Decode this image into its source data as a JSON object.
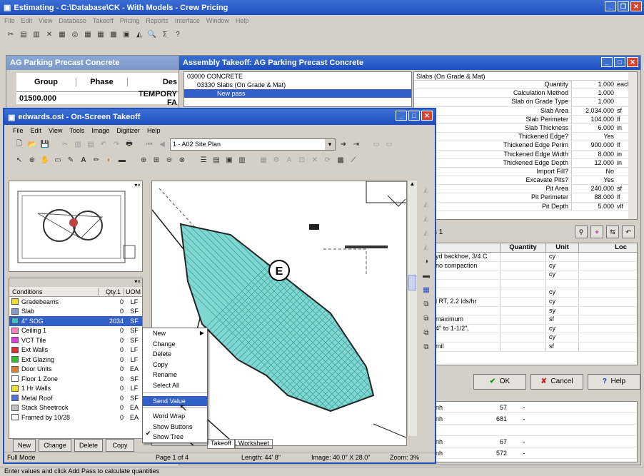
{
  "main": {
    "title": "Estimating - C:\\Database\\CK - With Models - Crew Pricing",
    "menu": [
      "File",
      "Edit",
      "View",
      "Database",
      "Takeoff",
      "Pricing",
      "Reports",
      "Interface",
      "Window",
      "Help"
    ]
  },
  "ag": {
    "title": "AG Parking Precast Concrete",
    "headers": [
      "Group",
      "Phase",
      "Des"
    ],
    "row": [
      "01500.000",
      "",
      "TEMPORY FA"
    ]
  },
  "assembly": {
    "title": "Assembly Takeoff:  AG Parking Precast Concrete",
    "tree": [
      "03000  CONCRETE",
      "03330  Slabs (On Grade & Mat)",
      "New pass"
    ],
    "props_title": "Slabs (On Grade & Mat)",
    "props": [
      {
        "label": "Quantity",
        "value": "1.000",
        "unit": "each"
      },
      {
        "label": "Calculation Method",
        "value": "1.000",
        "unit": ""
      },
      {
        "label": "Slab on Grade Type",
        "value": "1.000",
        "unit": ""
      },
      {
        "label": "Slab Area",
        "value": "2,034.000",
        "unit": "sf"
      },
      {
        "label": "Slab Perimeter",
        "value": "104.000",
        "unit": "lf"
      },
      {
        "label": "Slab Thickness",
        "value": "6.000",
        "unit": "in"
      },
      {
        "label": "Thickened Edge?",
        "value": "Yes",
        "unit": ""
      },
      {
        "label": "Thickened Edge Perim",
        "value": "900.000",
        "unit": "lf"
      },
      {
        "label": "Thickened Edge Width",
        "value": "8.000",
        "unit": "in"
      },
      {
        "label": "Thickened Edge Depth",
        "value": "12.000",
        "unit": "in"
      },
      {
        "label": "Import Fill?",
        "value": "No",
        "unit": ""
      },
      {
        "label": "Excavate Pits?",
        "value": "Yes",
        "unit": ""
      },
      {
        "label": "Pit Area",
        "value": "240.000",
        "unit": "sf"
      },
      {
        "label": "Pit Perimeter",
        "value": "88.000",
        "unit": "lf"
      },
      {
        "label": "Pit Depth",
        "value": "5.000",
        "unit": "vlf"
      }
    ],
    "pass_label": "s 1",
    "grid_headers": [
      "Quantity",
      "Unit",
      "Loc"
    ],
    "grid_rows": [
      [
        "yd backhoe, 3/4 C",
        "",
        "cy"
      ],
      [
        "no compaction",
        "",
        "cy"
      ],
      [
        "",
        "",
        "cy"
      ],
      [
        "",
        "",
        ""
      ],
      [
        "",
        "",
        "cy"
      ],
      [
        "l RT, 2.2 lds/hr",
        "",
        "cy"
      ],
      [
        "",
        "",
        "sy"
      ],
      [
        "maximum",
        "",
        "sf"
      ],
      [
        "4\" to 1-1/2\",",
        "",
        "cy"
      ],
      [
        "",
        "",
        "cy"
      ],
      [
        "mil",
        "",
        "sf"
      ]
    ],
    "ok": "OK",
    "cancel": "Cancel",
    "help": "Help",
    "bottom_rows": [
      [
        "nh",
        "57",
        "-"
      ],
      [
        "nh",
        "681",
        "-"
      ],
      [
        "",
        "",
        " "
      ],
      [
        "nh",
        "67",
        "-"
      ],
      [
        "nh",
        "572",
        "-"
      ]
    ]
  },
  "ost": {
    "title": "edwards.ost - On-Screen Takeoff",
    "menu": [
      "File",
      "Edit",
      "View",
      "Tools",
      "Image",
      "Digitizer",
      "Help"
    ],
    "page_select": "1 - A02 Site Plan",
    "cond_headers": [
      "Conditions",
      "Qty.1",
      "UOM"
    ],
    "conditions": [
      {
        "name": "Gradebeams",
        "qty": "0",
        "uom": "LF",
        "color": "#f0e020"
      },
      {
        "name": "Slab",
        "qty": "0",
        "uom": "SF",
        "color": "#8899cc"
      },
      {
        "name": "4\" SOG",
        "qty": "2034",
        "uom": "SF",
        "color": "#40c0c0"
      },
      {
        "name": "Ceiling 1",
        "qty": "0",
        "uom": "SF",
        "color": "#ff80c0"
      },
      {
        "name": "VCT Tile",
        "qty": "0",
        "uom": "SF",
        "color": "#e040e0"
      },
      {
        "name": "Ext Walls",
        "qty": "0",
        "uom": "LF",
        "color": "#e03030"
      },
      {
        "name": "Ext Glazing",
        "qty": "0",
        "uom": "LF",
        "color": "#30c030"
      },
      {
        "name": "Door Units",
        "qty": "0",
        "uom": "EA",
        "color": "#e08020"
      },
      {
        "name": "Floor 1 Zone",
        "qty": "0",
        "uom": "SF",
        "color": "#ffffff"
      },
      {
        "name": "1 Hr Walls",
        "qty": "0",
        "uom": "LF",
        "color": "#f0e020"
      },
      {
        "name": "Metal Roof",
        "qty": "0",
        "uom": "SF",
        "color": "#5070e0"
      },
      {
        "name": "Stack Sheetrock",
        "qty": "0",
        "uom": "EA",
        "color": "#c0c0c0"
      },
      {
        "name": "Framed by 10/28",
        "qty": "0",
        "uom": "EA",
        "color": "#ffffff"
      }
    ],
    "buttons": [
      "New",
      "Change",
      "Delete",
      "Copy"
    ],
    "tabs": [
      "Takeoff",
      "Worksheet"
    ],
    "status": [
      "Full Mode",
      "Page 1 of 4",
      "Length: 44' 8\"",
      "Image: 40.0\" X 28.0\"",
      "Zoom: 3%"
    ],
    "marker": "E"
  },
  "context_menu": [
    "New",
    "Change",
    "Delete",
    "Copy",
    "Rename",
    "Select All",
    "Send Value",
    "Word Wrap",
    "Show Buttons",
    "Show Tree"
  ],
  "statusbar": "Enter values and click Add Pass to calculate quantities"
}
